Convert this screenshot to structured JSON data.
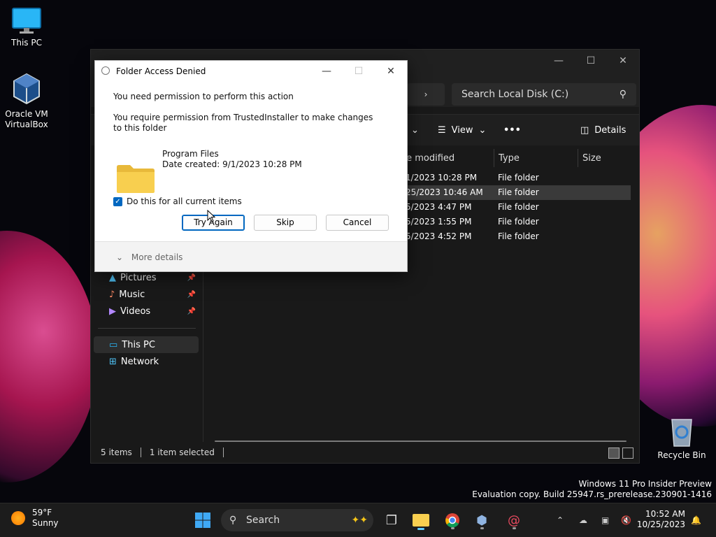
{
  "desktop": {
    "icons": [
      {
        "label": "This PC"
      },
      {
        "label": "Oracle VM VirtualBox"
      },
      {
        "label": "Recycle Bin"
      }
    ],
    "watermark": {
      "line1": "Windows 11 Pro Insider Preview",
      "line2": "Evaluation copy. Build 25947.rs_prerelease.230901-1416"
    }
  },
  "explorer": {
    "search_placeholder": "Search Local Disk (C:)",
    "toolbar": {
      "view_label": "View",
      "more_label": "•••",
      "details_label": "Details"
    },
    "columns": [
      "te modified",
      "Type",
      "Size"
    ],
    "sidebar": [
      {
        "label": "Pictures",
        "icon": "pictures-icon",
        "pinned": true
      },
      {
        "label": "Music",
        "icon": "music-icon",
        "pinned": true
      },
      {
        "label": "Videos",
        "icon": "videos-icon",
        "pinned": true
      },
      {
        "label": "This PC",
        "icon": "this-pc-icon",
        "selected": true
      },
      {
        "label": "Network",
        "icon": "network-icon"
      }
    ],
    "rows": [
      {
        "date": "/1/2023 10:28 PM",
        "type": "File folder"
      },
      {
        "date": "/25/2023 10:46 AM",
        "type": "File folder",
        "selected": true
      },
      {
        "date": "/5/2023 4:47 PM",
        "type": "File folder"
      },
      {
        "date": "/5/2023 1:55 PM",
        "type": "File folder"
      },
      {
        "date": "/5/2023 4:52 PM",
        "type": "File folder"
      }
    ],
    "status": {
      "items": "5 items",
      "selected": "1 item selected"
    }
  },
  "dialog": {
    "title": "Folder Access Denied",
    "heading": "You need permission to perform this action",
    "message": "You require permission from TrustedInstaller to make changes to this folder",
    "folder_name": "Program Files",
    "folder_date": "Date created: 9/1/2023 10:28 PM",
    "checkbox_label": "Do this for all current items",
    "checkbox_checked": true,
    "buttons": {
      "try_again": "Try Again",
      "skip": "Skip",
      "cancel": "Cancel"
    },
    "more_details": "More details"
  },
  "taskbar": {
    "weather": {
      "temp": "59°F",
      "condition": "Sunny"
    },
    "search_label": "Search",
    "clock": {
      "time": "10:52 AM",
      "date": "10/25/2023"
    }
  },
  "colors": {
    "accent": "#0067c0",
    "taskbar_indicator": "#60cdff",
    "folder": "#f8cf4f"
  }
}
